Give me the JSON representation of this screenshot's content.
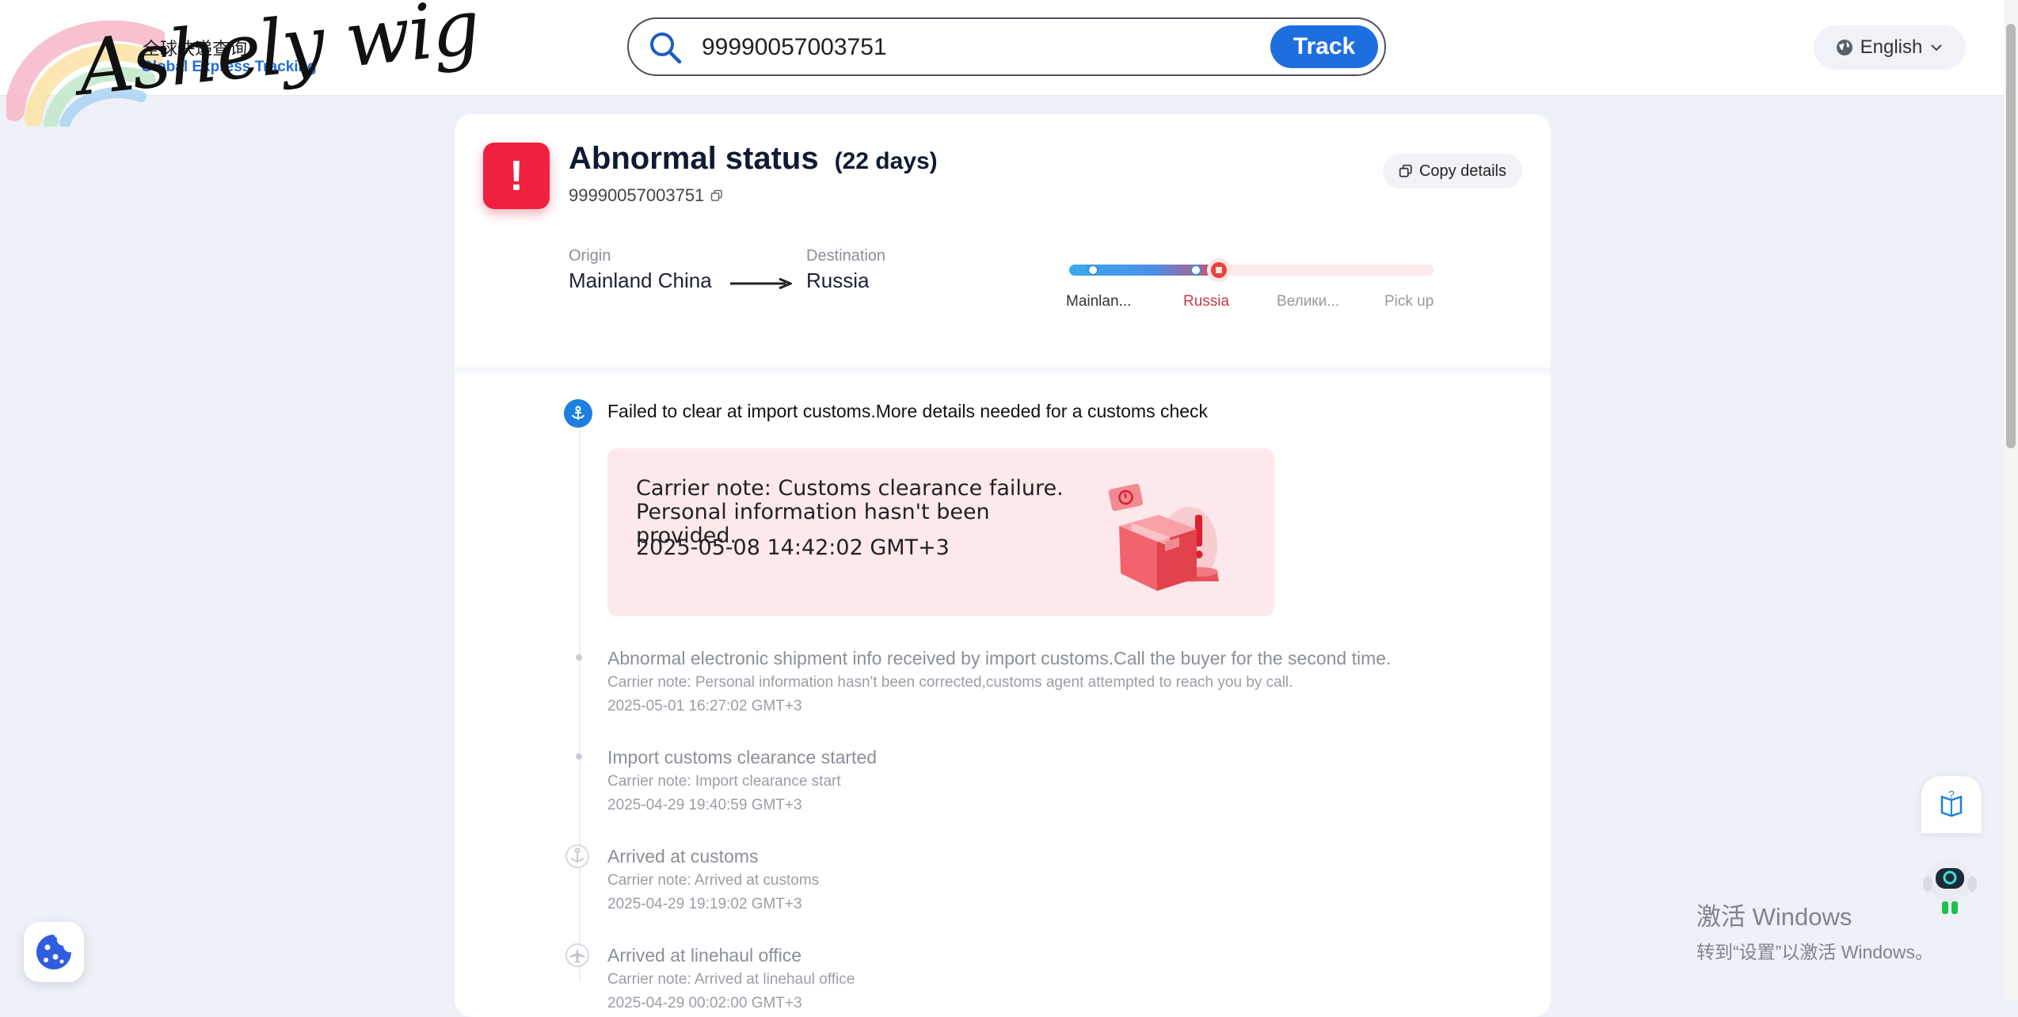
{
  "header": {
    "logo_cn": "全球快递查询",
    "logo_en": "Global Express Tracking",
    "logo_script": "Ashely wig",
    "search_value": "99990057003751",
    "track_label": "Track",
    "language": "English"
  },
  "status": {
    "badge": "!",
    "title": "Abnormal status",
    "days": "(22 days)",
    "tracking_number": "99990057003751",
    "copy_label": "Copy details",
    "origin_label": "Origin",
    "origin": "Mainland China",
    "destination_label": "Destination",
    "destination": "Russia"
  },
  "progress": {
    "stages": [
      "Mainlan...",
      "Russia",
      "Велики...",
      "Pick up"
    ],
    "active_stage_index": 1,
    "colors": {
      "start": "#3aa8ef",
      "end": "#e34a5b",
      "inactive": "#fbe9eb"
    }
  },
  "events": {
    "first": {
      "title": "Failed to clear at import customs.More details needed for a customs check",
      "note": "Carrier note: Customs clearance failure. Personal information hasn't been provided.",
      "time": "2025-05-08 14:42:02 GMT+3"
    },
    "list": [
      {
        "title": "Abnormal electronic shipment info received by import customs.Call the buyer for the second time.",
        "note": "Carrier note: Personal information hasn't been corrected,customs agent attempted to reach you by call.",
        "time": "2025-05-01 16:27:02 GMT+3"
      },
      {
        "title": "Import customs clearance started",
        "note": "Carrier note: Import clearance start",
        "time": "2025-04-29 19:40:59 GMT+3"
      },
      {
        "title": "Arrived at customs",
        "note": "Carrier note: Arrived at customs",
        "time": "2025-04-29 19:19:02 GMT+3"
      },
      {
        "title": "Arrived at linehaul office",
        "note": "Carrier note: Arrived at linehaul office",
        "time": "2025-04-29 00:02:00 GMT+3"
      }
    ]
  },
  "watermark": {
    "line1": "激活 Windows",
    "line2": "转到“设置”以激活 Windows。"
  },
  "colors": {
    "accent": "#1d6fe0",
    "danger": "#f0213f",
    "note_bg": "#fde9ec"
  }
}
